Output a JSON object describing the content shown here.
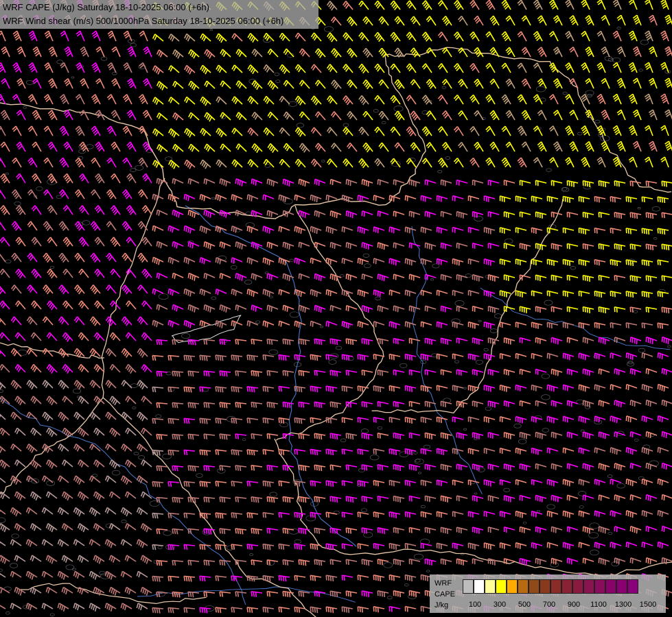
{
  "header": {
    "line1": "WRF CAPE (J/kg) Saturday 18-10-2025 06:00 (+6h)",
    "line2": "WRF Wind shear (m/s) 500/1000hPa Saturday 18-10-2025 06:00 (+6h)"
  },
  "legend": {
    "label_line1": "WRF",
    "label_line2": "CAPE",
    "label_line3": "J/kg",
    "swatch_colors": [
      "#bdbdbd",
      "#ffffff",
      "#ffff99",
      "#ffff00",
      "#ffaa00",
      "#b86a10",
      "#8e4a18",
      "#8a3a1c",
      "#8a2d2a",
      "#8a2235",
      "#8a1a40",
      "#8a1450",
      "#8a0c5c",
      "#880468",
      "#8a0070",
      "#8a007a"
    ],
    "ticks": [
      "100",
      "300",
      "500",
      "700",
      "900",
      "1100",
      "1300",
      "1500"
    ]
  },
  "wind_colors": {
    "pink": "#ff00ff",
    "yellow": "#ffff00",
    "salmon": "#f08a78",
    "rose": "#c07a78",
    "tan": "#c2a07a",
    "grey": "#b89a9a"
  },
  "lines": {
    "border_color": "#e8c8a8",
    "river_color": "#4a7ad0",
    "terrain_color": "#9a9aaa"
  }
}
